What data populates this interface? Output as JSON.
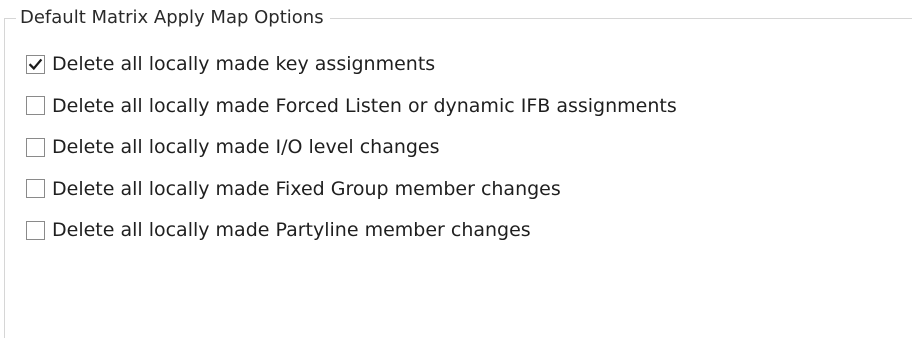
{
  "groupbox": {
    "title": "Default Matrix Apply Map Options"
  },
  "options": [
    {
      "label": "Delete all locally made key assignments",
      "checked": true
    },
    {
      "label": "Delete all locally made Forced Listen or dynamic IFB assignments",
      "checked": false
    },
    {
      "label": "Delete all locally made I/O level changes",
      "checked": false
    },
    {
      "label": "Delete all locally made Fixed Group member changes",
      "checked": false
    },
    {
      "label": "Delete all locally made Partyline member changes",
      "checked": false
    }
  ],
  "colors": {
    "border": "#d6d6d6",
    "checkbox_border": "#8a8a8a",
    "checkmark": "#1a1a1a"
  },
  "icons": {
    "checked_indicator": "checkmark-icon"
  }
}
